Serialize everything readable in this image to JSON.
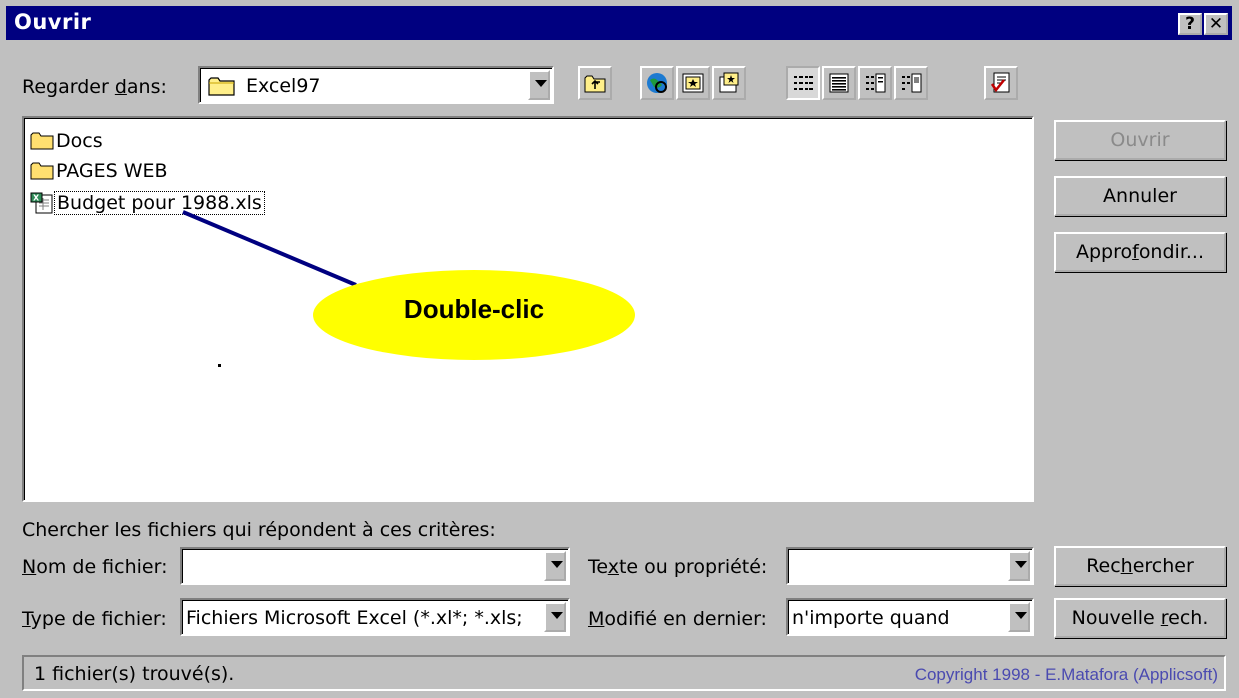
{
  "window": {
    "title": "Ouvrir",
    "help_label": "?",
    "close_label": "✕"
  },
  "lookin": {
    "label_pre": "Regarder ",
    "label_accel": "d",
    "label_post": "ans:",
    "value": "Excel97"
  },
  "toolbar": {
    "tools": [
      {
        "name": "up-one-level-icon"
      },
      {
        "name": "search-web-icon"
      },
      {
        "name": "favorites-icon"
      },
      {
        "name": "add-to-favorites-icon"
      },
      {
        "name": "list-view-icon"
      },
      {
        "name": "details-view-icon"
      },
      {
        "name": "properties-view-icon"
      },
      {
        "name": "preview-view-icon"
      },
      {
        "name": "commands-settings-icon"
      }
    ]
  },
  "files": [
    {
      "name": "Docs",
      "type": "folder"
    },
    {
      "name": "PAGES WEB",
      "type": "folder"
    },
    {
      "name": "Budget pour 1988.xls",
      "type": "excel"
    }
  ],
  "callout": {
    "text": "Double-clic",
    "color": "#ffff00"
  },
  "buttons": {
    "open": "Ouvrir",
    "cancel": "Annuler",
    "advanced_pre": "Appro",
    "advanced_accel": "f",
    "advanced_post": "ondir...",
    "search_pre": "Rec",
    "search_accel": "h",
    "search_post": "ercher",
    "new_search_pre": "Nouvelle ",
    "new_search_accel": "r",
    "new_search_post": "ech."
  },
  "criteria": {
    "heading": "Chercher les fichiers qui répondent à ces critères:",
    "filename_label_accel": "N",
    "filename_label_post": "om de fichier:",
    "filename_value": "",
    "filetype_label_accel": "T",
    "filetype_label_post": "ype de fichier:",
    "filetype_value": "Fichiers Microsoft Excel (*.xl*; *.xls;",
    "text_label_pre": "Te",
    "text_label_accel": "x",
    "text_label_post": "te ou propriété:",
    "text_value": "",
    "modified_label_accel": "M",
    "modified_label_post": "odifié en dernier:",
    "modified_value": "n'importe quand"
  },
  "status": {
    "found": "1 fichier(s) trouvé(s).",
    "copyright": "Copyright 1998 - E.Matafora (Applicsoft)"
  },
  "colors": {
    "titlebar": "#000080",
    "face": "#c0c0c0",
    "copyright_text": "#4a4ab0"
  }
}
